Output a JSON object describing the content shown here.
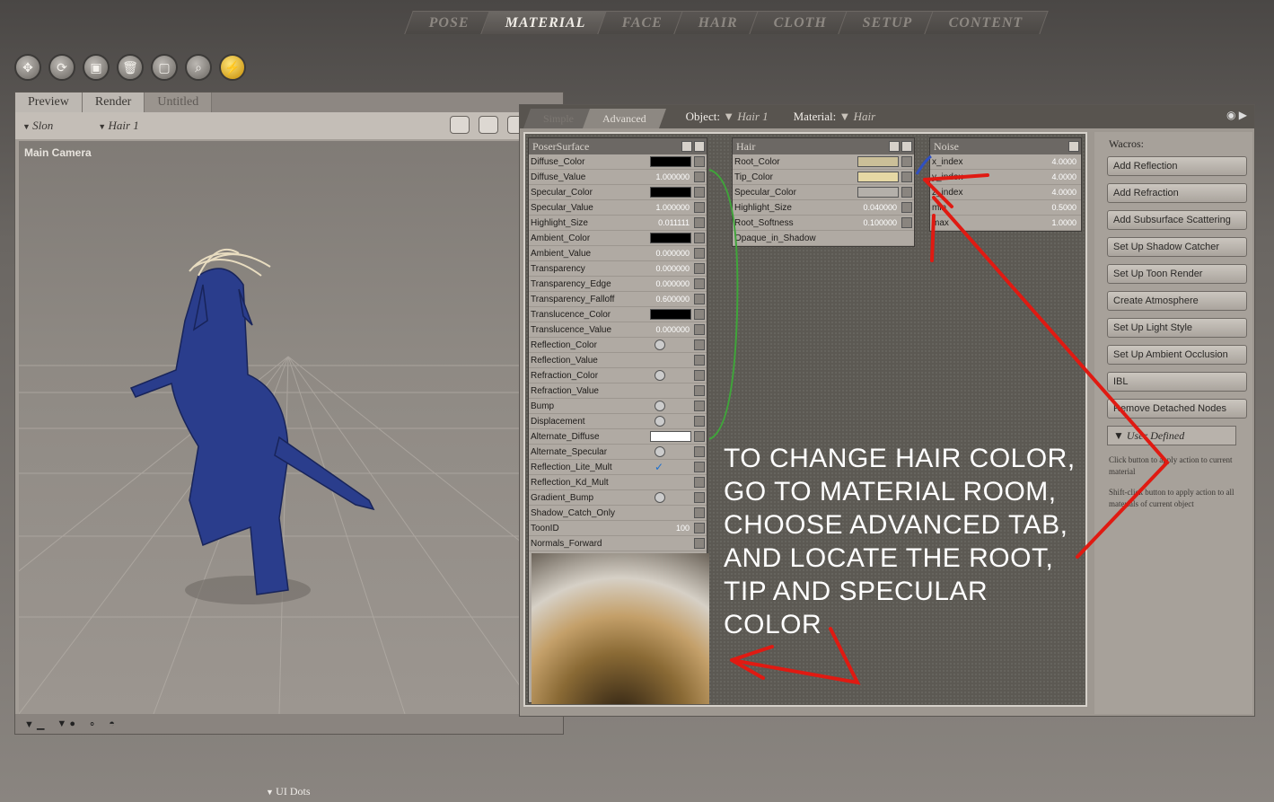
{
  "rooms": [
    "POSE",
    "MATERIAL",
    "FACE",
    "HAIR",
    "CLOTH",
    "SETUP",
    "CONTENT"
  ],
  "active_room": "MATERIAL",
  "toolbar_icons": [
    "move-icon",
    "rotate-icon",
    "camera-icon",
    "trash-icon",
    "frame-icon",
    "zoom-icon",
    "render-icon"
  ],
  "preview": {
    "tabs": [
      "Preview",
      "Render",
      "Untitled"
    ],
    "figure_dropdown": "Slon",
    "element_dropdown": "Hair 1",
    "camera_label": "Main Camera"
  },
  "material": {
    "tabs": [
      "Simple",
      "Advanced"
    ],
    "object_label": "Object:",
    "object_value": "Hair 1",
    "material_label": "Material:",
    "material_value": "Hair"
  },
  "poser_surface": {
    "title": "PoserSurface",
    "rows": [
      {
        "label": "Diffuse_Color",
        "kind": "swatch",
        "color": "#000000"
      },
      {
        "label": "Diffuse_Value",
        "kind": "value",
        "value": "1.000000"
      },
      {
        "label": "Specular_Color",
        "kind": "swatch",
        "color": "#000000"
      },
      {
        "label": "Specular_Value",
        "kind": "value",
        "value": "1.000000"
      },
      {
        "label": "Highlight_Size",
        "kind": "value",
        "value": "0.011111"
      },
      {
        "label": "Ambient_Color",
        "kind": "swatch",
        "color": "#000000"
      },
      {
        "label": "Ambient_Value",
        "kind": "value",
        "value": "0.000000"
      },
      {
        "label": "Transparency",
        "kind": "value",
        "value": "0.000000"
      },
      {
        "label": "Transparency_Edge",
        "kind": "value",
        "value": "0.000000"
      },
      {
        "label": "Transparency_Falloff",
        "kind": "value",
        "value": "0.600000"
      },
      {
        "label": "Translucence_Color",
        "kind": "swatch",
        "color": "#000000"
      },
      {
        "label": "Translucence_Value",
        "kind": "value",
        "value": "0.000000"
      },
      {
        "label": "Reflection_Color",
        "kind": "dial"
      },
      {
        "label": "Reflection_Value",
        "kind": "none"
      },
      {
        "label": "Refraction_Color",
        "kind": "dial"
      },
      {
        "label": "Refraction_Value",
        "kind": "none"
      },
      {
        "label": "Bump",
        "kind": "dial"
      },
      {
        "label": "Displacement",
        "kind": "dial"
      },
      {
        "label": "Alternate_Diffuse",
        "kind": "swatch",
        "color": "#ffffff"
      },
      {
        "label": "Alternate_Specular",
        "kind": "dial"
      },
      {
        "label": "Reflection_Lite_Mult",
        "kind": "check"
      },
      {
        "label": "Reflection_Kd_Mult",
        "kind": "none"
      },
      {
        "label": "Gradient_Bump",
        "kind": "dial"
      },
      {
        "label": "Shadow_Catch_Only",
        "kind": "none"
      },
      {
        "label": "ToonID",
        "kind": "value",
        "value": "100"
      },
      {
        "label": "Normals_Forward",
        "kind": "none"
      }
    ]
  },
  "hair_node": {
    "title": "Hair",
    "rows": [
      {
        "label": "Root_Color",
        "kind": "swatch",
        "color": "#cbbf98"
      },
      {
        "label": "Tip_Color",
        "kind": "swatch",
        "color": "#e6d8a4"
      },
      {
        "label": "Specular_Color",
        "kind": "swatch",
        "color": "#b4b0aa"
      },
      {
        "label": "Highlight_Size",
        "kind": "value",
        "value": "0.040000"
      },
      {
        "label": "Root_Softness",
        "kind": "value",
        "value": "0.100000"
      },
      {
        "label": "Opaque_in_Shadow",
        "kind": "none"
      }
    ]
  },
  "noise_node": {
    "title": "Noise",
    "rows": [
      {
        "label": "x_index",
        "value": "4.0000"
      },
      {
        "label": "y_index",
        "value": "4.0000"
      },
      {
        "label": "z_index",
        "value": "4.0000"
      },
      {
        "label": "min",
        "value": "0.5000"
      },
      {
        "label": "max",
        "value": "1.0000"
      }
    ]
  },
  "wacros": {
    "title": "Wacros:",
    "buttons": [
      "Add Reflection",
      "Add Refraction",
      "Add Subsurface Scattering",
      "Set Up Shadow Catcher",
      "Set Up Toon Render",
      "Create Atmosphere",
      "Set Up Light Style",
      "Set Up Ambient Occlusion",
      "IBL",
      "Remove Detached Nodes"
    ],
    "user_defined": "User Defined",
    "help1": "Click button to apply action to current material",
    "help2": "Shift-click button to apply action to all materials of current object"
  },
  "annotation": "TO CHANGE HAIR COLOR,\nGO TO MATERIAL ROOM,\nCHOOSE ADVANCED TAB,\nAND LOCATE THE ROOT,\nTIP AND SPECULAR\nCOLOR",
  "ui_dots_label": "UI Dots",
  "colors": {
    "arrow": "#e01a12",
    "figure": "#2a3d8c"
  }
}
